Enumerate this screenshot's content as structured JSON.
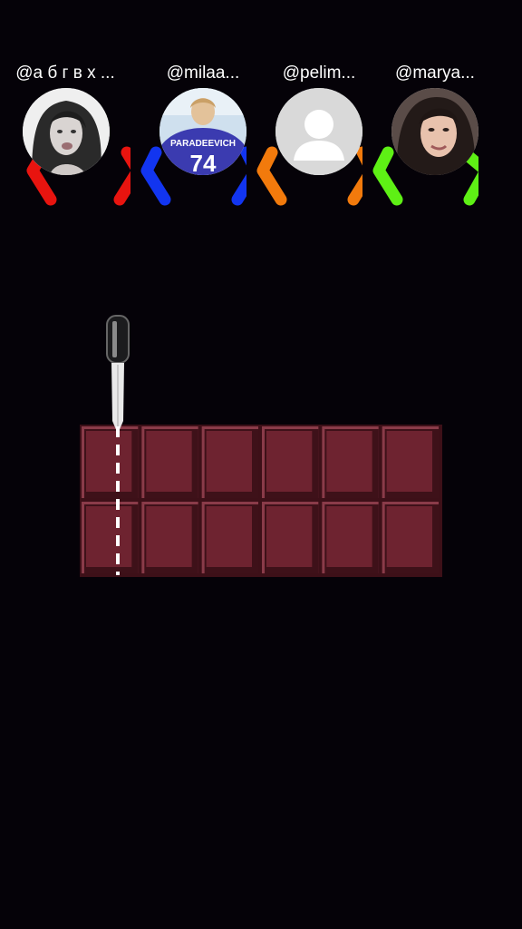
{
  "players": [
    {
      "username": "@а б г в х ...",
      "color": "#e8140f",
      "avatar_icon": "girl-photo-avatar"
    },
    {
      "username": "@milaa...",
      "color": "#1235f0",
      "avatar_icon": "football-player-photo-avatar",
      "jersey_name": "PARADEEVICH",
      "jersey_number": "74"
    },
    {
      "username": "@pelim...",
      "color": "#f27a0c",
      "avatar_icon": "default-user-avatar"
    },
    {
      "username": "@marya...",
      "color": "#5ef015",
      "avatar_icon": "woman-photo-avatar"
    }
  ],
  "chocolate": {
    "rows": 2,
    "columns": 6,
    "piece_color": "#6e2330",
    "cut_line_after_column": 0
  },
  "knife_icon": "knife-icon"
}
